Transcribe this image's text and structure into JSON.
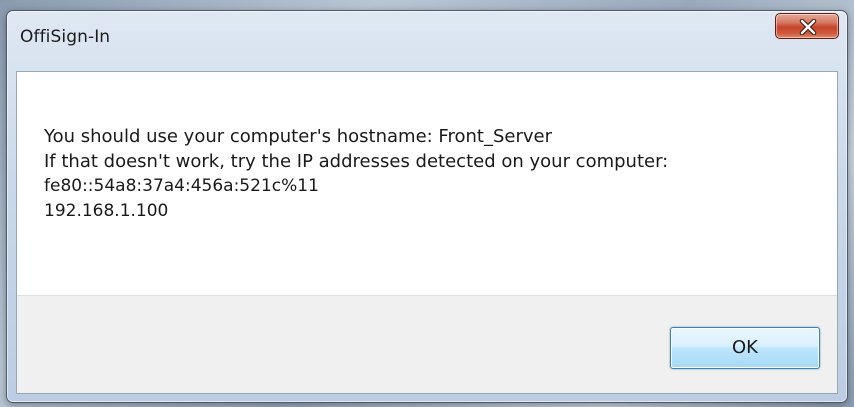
{
  "window": {
    "title": "OffiSign-In"
  },
  "message": {
    "line1": "You should use your computer's hostname: Front_Server",
    "line2": "If that doesn't work, try the IP addresses detected on your computer:",
    "line3": "fe80::54a8:37a4:456a:521c%11",
    "line4": "192.168.1.100"
  },
  "buttons": {
    "ok_label": "OK"
  },
  "icons": {
    "close": "close-icon"
  },
  "colors": {
    "close_button": "#c5442a",
    "ok_button_border": "#3c7fb1",
    "button_area_bg": "#f0f0f0"
  }
}
